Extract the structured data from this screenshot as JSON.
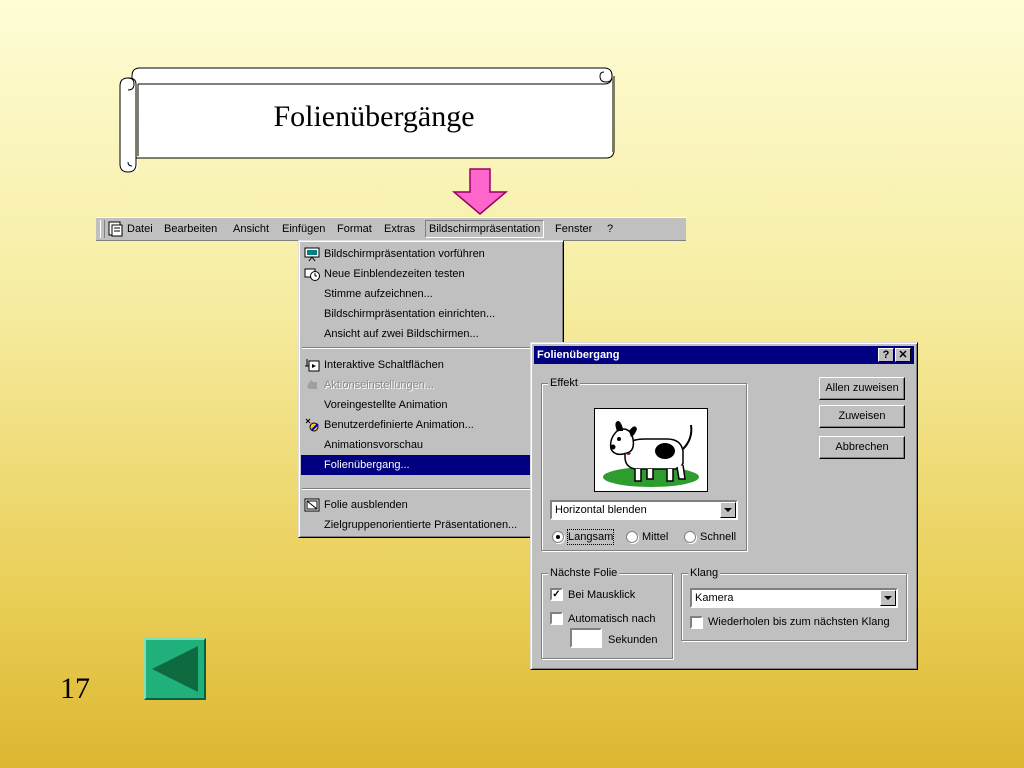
{
  "title": "Folienübergänge",
  "slide_number": "17",
  "menubar": {
    "items": [
      {
        "label": "Datei"
      },
      {
        "label": "Bearbeiten"
      },
      {
        "label": "Ansicht"
      },
      {
        "label": "Einfügen"
      },
      {
        "label": "Format"
      },
      {
        "label": "Extras"
      },
      {
        "label": "Bildschirmpräsentation"
      },
      {
        "label": "Fenster"
      },
      {
        "label": "?"
      }
    ],
    "active": "Bildschirmpräsentation"
  },
  "dropdown": {
    "items": [
      {
        "label": "Bildschirmpräsentation vorführen",
        "icon": "slideshow-icon"
      },
      {
        "label": "Neue Einblendezeiten testen",
        "icon": "timer-icon"
      },
      {
        "label": "Stimme aufzeichnen..."
      },
      {
        "label": "Bildschirmpräsentation einrichten..."
      },
      {
        "label": "Ansicht auf zwei Bildschirmen..."
      },
      {
        "label": "Interaktive Schaltflächen",
        "icon": "action-button-icon"
      },
      {
        "label": "Aktionseinstellungen...",
        "icon": "action-settings-icon",
        "disabled": true
      },
      {
        "label": "Voreingestellte Animation"
      },
      {
        "label": "Benutzerdefinierte Animation...",
        "icon": "custom-animation-icon"
      },
      {
        "label": "Animationsvorschau"
      },
      {
        "label": "Folienübergang...",
        "selected": true
      },
      {
        "label": "Folie ausblenden",
        "icon": "hide-slide-icon"
      },
      {
        "label": "Zielgruppenorientierte Präsentationen..."
      }
    ]
  },
  "dialog": {
    "title": "Folienübergang",
    "help_label": "?",
    "close_label": "✕",
    "effect_group": "Effekt",
    "effect_value": "Horizontal blenden",
    "speed": {
      "options": [
        "Langsam",
        "Mittel",
        "Schnell"
      ],
      "selected": "Langsam"
    },
    "buttons": {
      "apply_all": "Allen zuweisen",
      "apply": "Zuweisen",
      "cancel": "Abbrechen"
    },
    "next_slide_group": "Nächste Folie",
    "on_click_label": "Bei Mausklick",
    "on_click_checked": true,
    "auto_label": "Automatisch nach",
    "auto_checked": false,
    "seconds_value": "",
    "seconds_label": "Sekunden",
    "sound_group": "Klang",
    "sound_value": "Kamera",
    "loop_label": "Wiederholen bis zum nächsten Klang",
    "loop_checked": false
  },
  "colors": {
    "arrow": "#ff66cc",
    "highlight": "#000080",
    "nav_button": "#1fb07c",
    "nav_triangle": "#0d6b3f"
  }
}
